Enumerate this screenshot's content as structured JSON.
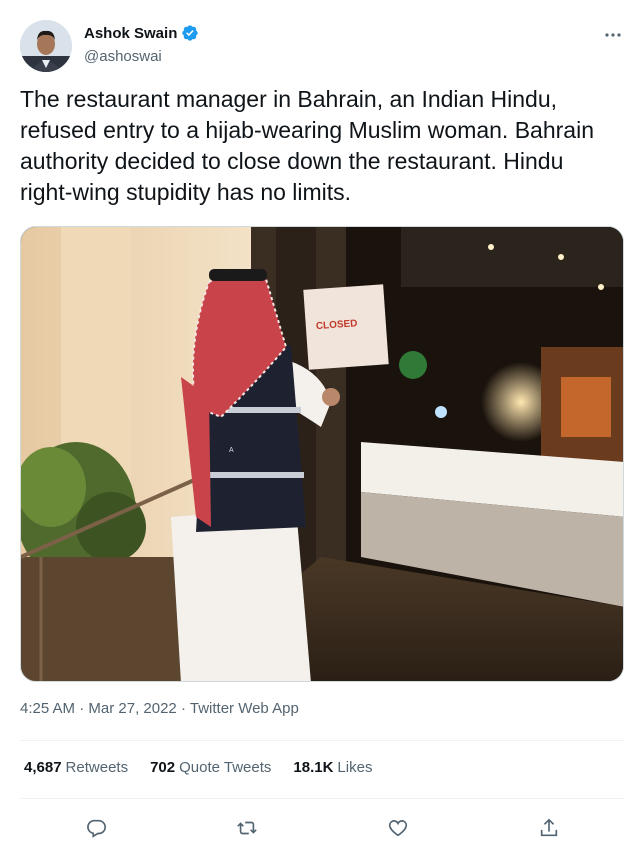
{
  "author": {
    "name": "Ashok Swain",
    "handle": "@ashoswai",
    "verified": true,
    "avatar_icon": "profile-photo"
  },
  "tweet": {
    "text": "The restaurant manager in Bahrain, an Indian Hindu, refused entry to a hijab-wearing Muslim woman. Bahrain authority decided to close down the restaurant. Hindu right-wing stupidity has no limits.",
    "photo_sign_text": "CLOSED"
  },
  "meta": {
    "time": "4:25 AM",
    "separator": "·",
    "date": "Mar 27, 2022",
    "source": "Twitter Web App"
  },
  "stats": {
    "retweets_count": "4,687",
    "retweets_label": "Retweets",
    "quotes_count": "702",
    "quotes_label": "Quote Tweets",
    "likes_count": "18.1K",
    "likes_label": "Likes"
  },
  "actions": [
    {
      "name": "reply-icon"
    },
    {
      "name": "retweet-icon"
    },
    {
      "name": "like-icon"
    },
    {
      "name": "share-icon"
    }
  ],
  "colors": {
    "text_primary": "#0f1419",
    "text_secondary": "#536471",
    "verified_blue": "#1d9bf0",
    "divider": "#eff3f4"
  }
}
